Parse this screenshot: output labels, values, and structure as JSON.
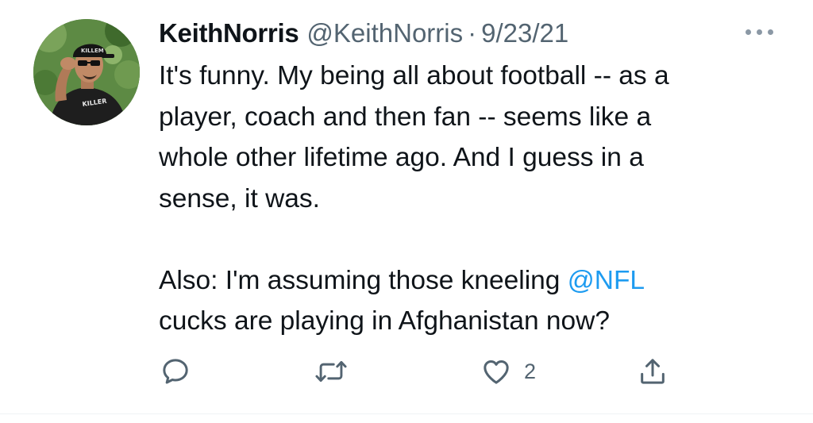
{
  "tweet": {
    "author": {
      "display_name": "KeithNorris",
      "handle": "@KeithNorris",
      "avatar_cap_text": "KILLEM",
      "avatar_shirt_text": "KILLER"
    },
    "separator": "·",
    "date": "9/23/21",
    "body": {
      "paragraph1_lines": [
        "It's funny. My being all about football -- as a",
        "player, coach and then fan -- seems like a",
        "whole other lifetime ago. And I guess in a",
        "sense, it was."
      ],
      "paragraph2_line1_prefix": "Also: I'm assuming those kneeling ",
      "mention": "@NFL",
      "paragraph2_line2": "cucks are playing in Afghanistan now?"
    },
    "actions": {
      "reply_icon": "speech-bubble-icon",
      "retweet_icon": "retweet-arrows-icon",
      "like_icon": "heart-outline-icon",
      "like_count": "2",
      "share_icon": "share-upload-icon"
    }
  },
  "colors": {
    "text_primary": "#0f1419",
    "text_secondary": "#536471",
    "link": "#1d9bf0",
    "divider": "#eff3f4"
  }
}
